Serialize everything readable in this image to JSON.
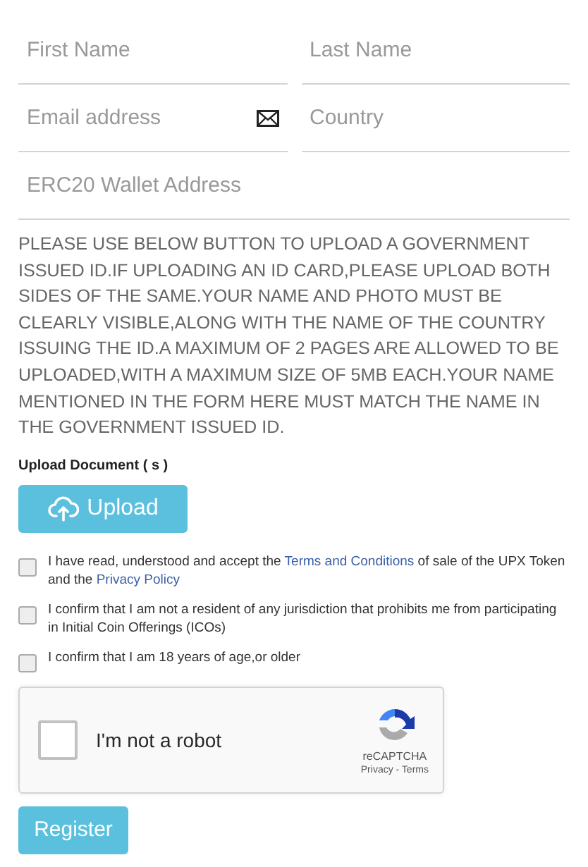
{
  "fields": [
    {
      "placeholder": "First Name"
    },
    {
      "placeholder": "Last Name"
    },
    {
      "placeholder": "Email address"
    },
    {
      "placeholder": "Country"
    },
    {
      "placeholder": "ERC20 Wallet Address"
    }
  ],
  "notice": "PLEASE USE BELOW BUTTON TO UPLOAD A GOVERNMENT ISSUED ID.IF UPLOADING AN ID CARD,PLEASE UPLOAD BOTH SIDES OF THE SAME.YOUR NAME AND PHOTO MUST BE CLEARLY VISIBLE,ALONG WITH THE NAME OF THE COUNTRY ISSUING THE ID.A MAXIMUM OF 2 PAGES ARE ALLOWED TO BE UPLOADED,WITH A MAXIMUM SIZE OF 5MB EACH.YOUR NAME MENTIONED IN THE FORM HERE MUST MATCH THE NAME IN THE GOVERNMENT ISSUED ID.",
  "upload": {
    "label": "Upload Document ( s )",
    "button": "Upload"
  },
  "agreements": [
    {
      "checked": false,
      "parts": [
        {
          "kind": "text",
          "text": "I have read, understood and accept the "
        },
        {
          "kind": "link",
          "text": "Terms and Conditions"
        },
        {
          "kind": "text",
          "text": " of sale of the UPX Token and the "
        },
        {
          "kind": "link",
          "text": "Privacy Policy"
        }
      ]
    },
    {
      "checked": false,
      "parts": [
        {
          "kind": "text",
          "text": "I confirm that I am not a resident of any jurisdiction that prohibits me from participating in Initial Coin Offerings (ICOs)"
        }
      ]
    },
    {
      "checked": false,
      "parts": [
        {
          "kind": "text",
          "text": "I confirm that I am 18 years of age,or older"
        }
      ]
    }
  ],
  "captcha": {
    "checked": false,
    "label": "I'm not a robot",
    "brand": "reCAPTCHA",
    "links": "Privacy - Terms"
  },
  "submit": "Register"
}
